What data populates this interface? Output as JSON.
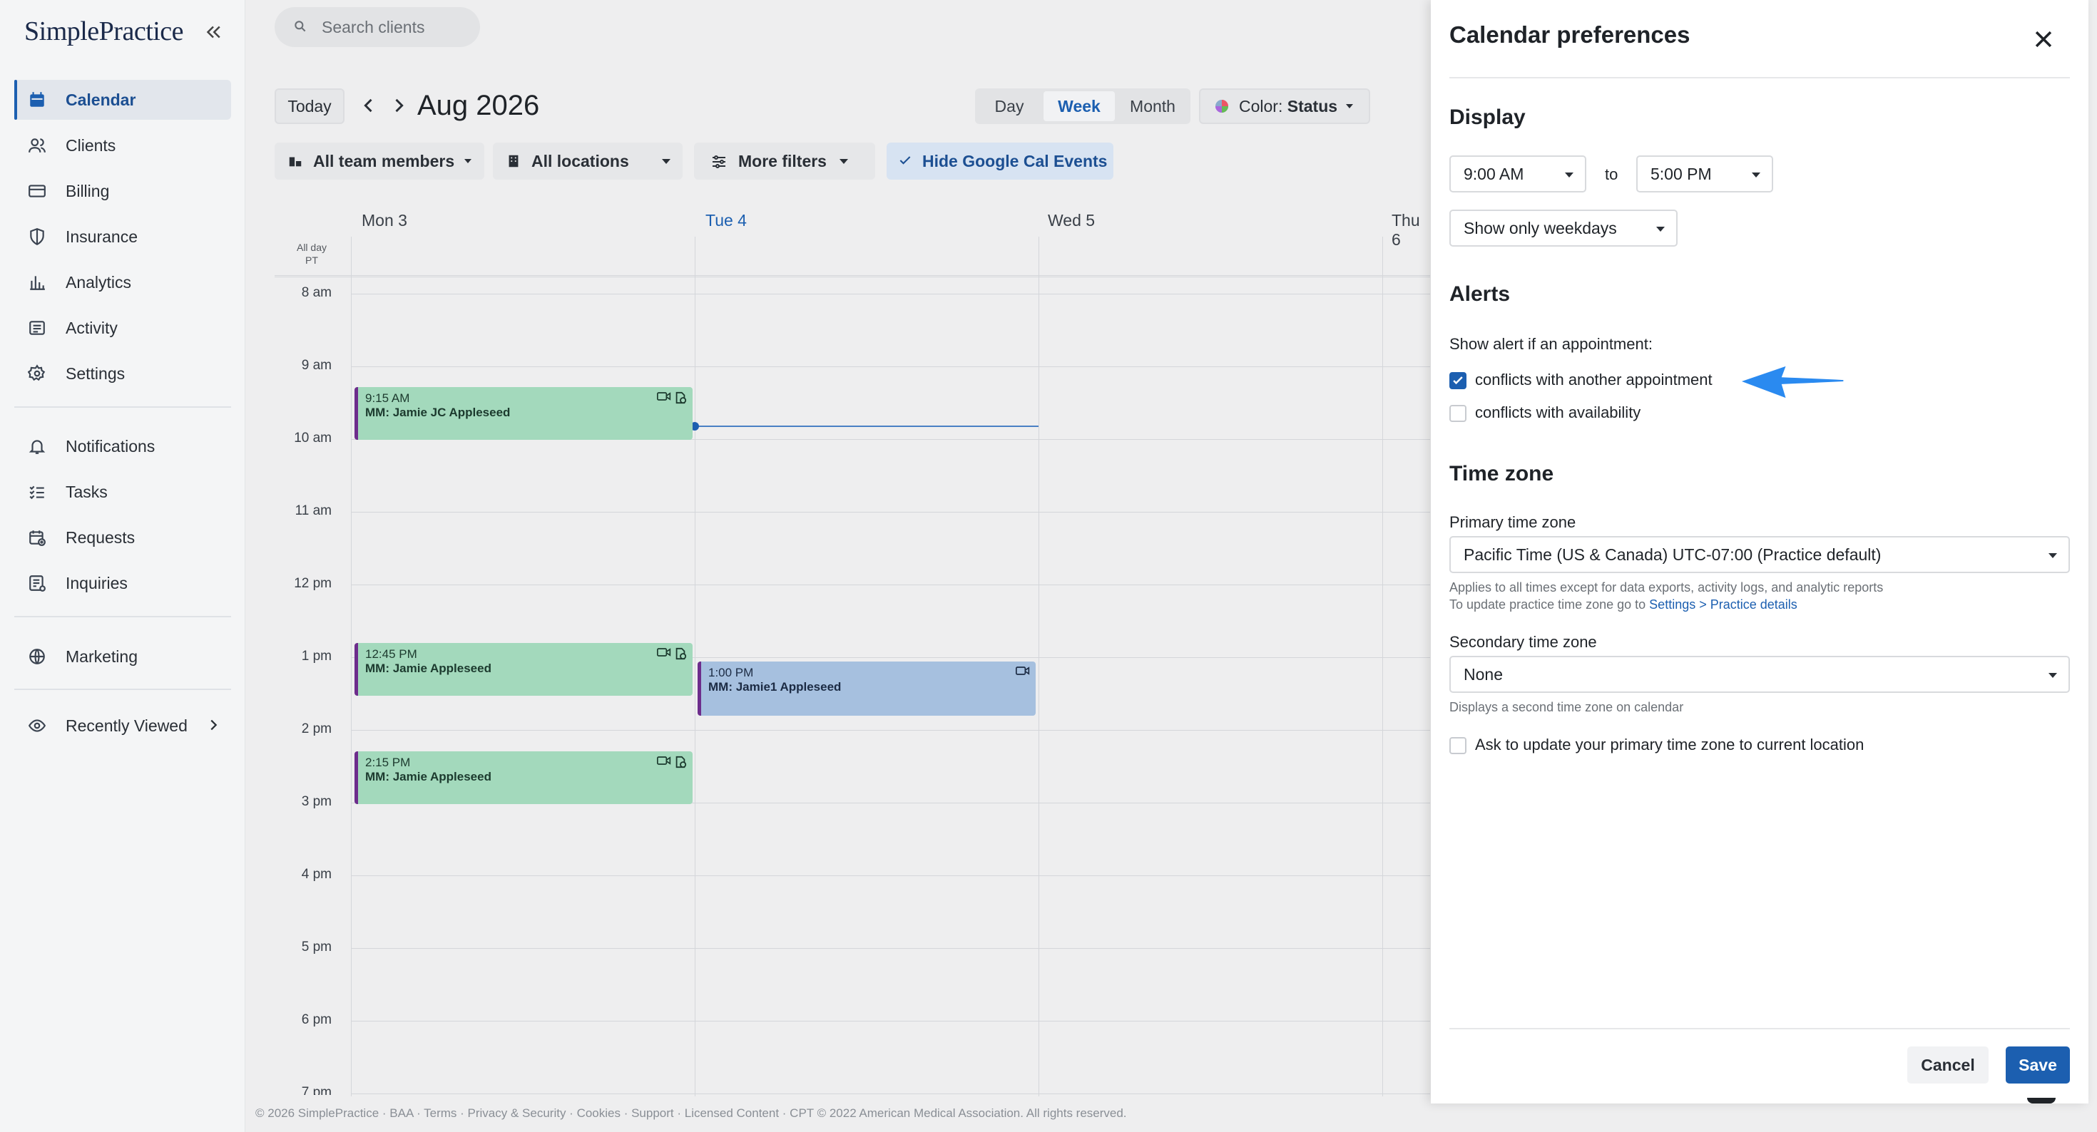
{
  "app": {
    "logo": "SimplePractice"
  },
  "sidebar": {
    "items": [
      {
        "label": "Calendar",
        "icon": "calendar-icon",
        "active": true
      },
      {
        "label": "Clients",
        "icon": "clients-icon"
      },
      {
        "label": "Billing",
        "icon": "credit-card-icon"
      },
      {
        "label": "Insurance",
        "icon": "shield-icon"
      },
      {
        "label": "Analytics",
        "icon": "bar-chart-icon"
      },
      {
        "label": "Activity",
        "icon": "activity-list-icon"
      },
      {
        "label": "Settings",
        "icon": "gear-icon"
      },
      {
        "label": "Notifications",
        "icon": "bell-icon"
      },
      {
        "label": "Tasks",
        "icon": "checklist-icon"
      },
      {
        "label": "Requests",
        "icon": "calendar-plus-icon"
      },
      {
        "label": "Inquiries",
        "icon": "inbox-icon"
      },
      {
        "label": "Marketing",
        "icon": "globe-icon"
      },
      {
        "label": "Recently Viewed",
        "icon": "eye-icon"
      }
    ]
  },
  "header": {
    "search_placeholder": "Search clients",
    "today": "Today",
    "month": "Aug 2026",
    "views": [
      "Day",
      "Week",
      "Month"
    ],
    "active_view": "Week",
    "color_prefix": "Color: ",
    "color_value": "Status"
  },
  "filters": {
    "team": "All team members",
    "locations": "All locations",
    "more": "More filters",
    "hide_gcal": "Hide Google Cal Events"
  },
  "calendar": {
    "days": [
      "Mon 3",
      "Tue 4",
      "Wed 5",
      "Thu 6"
    ],
    "allday": "All day",
    "tz": "PT",
    "hours": [
      "8 am",
      "9 am",
      "10 am",
      "11 am",
      "12 pm",
      "1 pm",
      "2 pm",
      "3 pm",
      "4 pm",
      "5 pm",
      "6 pm",
      "7 pm"
    ],
    "appointments": [
      {
        "time": "9:15 AM",
        "name": "MM: Jamie JC Appleseed"
      },
      {
        "time": "12:45 PM",
        "name": "MM: Jamie Appleseed"
      },
      {
        "time": "2:15 PM",
        "name": "MM: Jamie Appleseed"
      },
      {
        "time": "1:00 PM",
        "name": "MM: Jamie1 Appleseed"
      }
    ]
  },
  "footer": "© 2026 SimplePractice · BAA · Terms · Privacy & Security · Cookies · Support · Licensed Content · CPT © 2022 American Medical Association. All rights reserved.",
  "panel": {
    "title": "Calendar preferences",
    "display": {
      "heading": "Display",
      "start": "9:00 AM",
      "to": "to",
      "end": "5:00 PM",
      "days": "Show only weekdays"
    },
    "alerts": {
      "heading": "Alerts",
      "intro": "Show alert if an appointment:",
      "conflict_appt": "conflicts with another appointment",
      "conflict_avail": "conflicts with availability"
    },
    "tz": {
      "heading": "Time zone",
      "primary_label": "Primary time zone",
      "primary_value": "Pacific Time (US & Canada) UTC-07:00 (Practice default)",
      "help1": "Applies to all times except for data exports, activity logs, and analytic reports",
      "help2_prefix": "To update practice time zone go to ",
      "help2_link": "Settings > Practice details",
      "secondary_label": "Secondary time zone",
      "secondary_value": "None",
      "secondary_help": "Displays a second time zone on calendar",
      "ask_update": "Ask to update your primary time zone to current location"
    },
    "cancel": "Cancel",
    "save": "Save"
  }
}
